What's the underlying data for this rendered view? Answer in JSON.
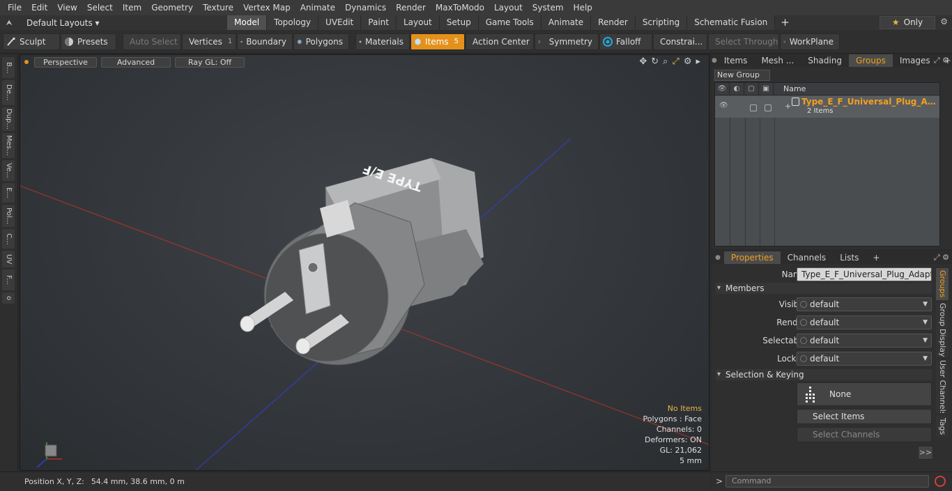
{
  "menu": [
    "File",
    "Edit",
    "View",
    "Select",
    "Item",
    "Geometry",
    "Texture",
    "Vertex Map",
    "Animate",
    "Dynamics",
    "Render",
    "MaxToModo",
    "Layout",
    "System",
    "Help"
  ],
  "layoutbar": {
    "layout_selector": "Default Layouts ▾",
    "tabs": [
      "Model",
      "Topology",
      "UVEdit",
      "Paint",
      "Layout",
      "Setup",
      "Game Tools",
      "Animate",
      "Render",
      "Scripting",
      "Schematic Fusion"
    ],
    "active_tab": "Model",
    "plus": "+",
    "only_label": "Only",
    "star": "★"
  },
  "toolbar": {
    "sculpt": "Sculpt",
    "presets": "Presets",
    "auto_select": "Auto Select",
    "vertices": "Vertices",
    "vertices_count": "1",
    "boundary": "Boundary",
    "polygons": "Polygons",
    "materials": "Materials",
    "items": "Items",
    "items_count": "5",
    "action_center": "Action Center",
    "symmetry": "Symmetry",
    "falloff": "Falloff",
    "constraints": "Constrai...",
    "select_through": "Select Through",
    "workplane": "WorkPlane"
  },
  "left_tabs": [
    "B...",
    "De...",
    "Dup...",
    "Mes...",
    "Ve...",
    "E...",
    "Pol...",
    "C...",
    "UV",
    "F...",
    "o"
  ],
  "viewport": {
    "view_mode": "Perspective",
    "shading": "Advanced",
    "raygl": "Ray GL: Off",
    "model_label": "TYPE E/F",
    "info": {
      "selection": "No Items",
      "polygons": "Polygons : Face",
      "channels": "Channels: 0",
      "deformers": "Deformers: ON",
      "gl": "GL: 21,062",
      "scale": "5 mm"
    }
  },
  "status": {
    "label": "Position X, Y, Z:",
    "value": "54.4 mm, 38.6 mm, 0 m"
  },
  "right_top": {
    "tabs": [
      "Items",
      "Mesh ...",
      "Shading",
      "Groups",
      "Images"
    ],
    "active_tab": "Groups",
    "plus": "+",
    "new_group": "New Group",
    "column_name": "Name",
    "group_name": "Type_E_F_Universal_Plug_Adap...",
    "group_sub": "2 Items"
  },
  "right_bottom": {
    "tabs": [
      "Properties",
      "Channels",
      "Lists"
    ],
    "active_tab": "Properties",
    "plus": "+",
    "name_label": "Name",
    "name_value": "Type_E_F_Universal_Plug_Adapter_Bl",
    "members_section": "Members",
    "visible_label": "Visible",
    "visible_value": "default",
    "render_label": "Render",
    "render_value": "default",
    "selectable_label": "Selectable",
    "selectable_value": "default",
    "locked_label": "Locked",
    "locked_value": "default",
    "selkey_section": "Selection & Keying",
    "none_btn": "None",
    "select_items_btn": "Select Items",
    "select_channels_btn": "Select Channels",
    "more_btn": ">>",
    "vtabs": [
      "Groups",
      "Group Display",
      "User Channels",
      "Tags"
    ],
    "active_vtab": "Groups"
  },
  "command": {
    "prompt": ">",
    "placeholder": "Command"
  },
  "colors": {
    "accent": "#e4911c",
    "group_name": "#f0a020",
    "axis_x": "#c0392b",
    "axis_z": "#3040c8"
  }
}
